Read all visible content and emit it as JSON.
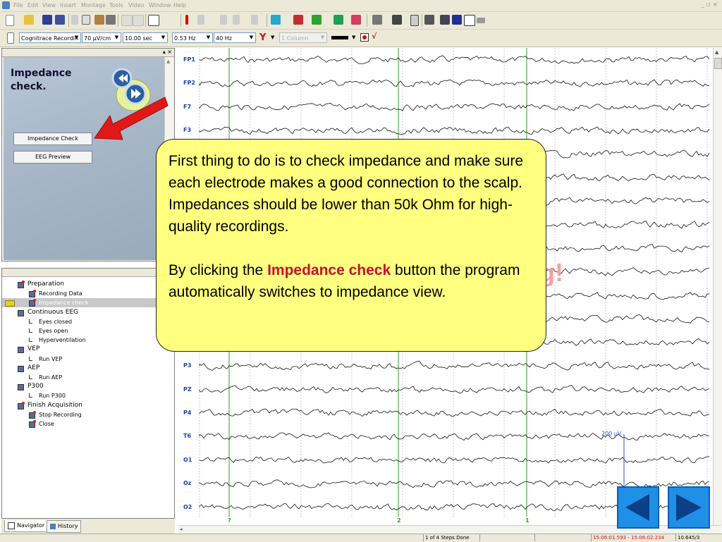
{
  "menu": [
    "File",
    "Edit",
    "View",
    "Insert",
    "Montage",
    "Tools",
    "Video",
    "Window",
    "Help"
  ],
  "window_buttons": "_ ▫ ×",
  "toolbar2": {
    "montage": "Cognitrace Recordin",
    "sensitivity": "70 µV/cm",
    "timebase": "10.00 sec",
    "lowcut": "0.53 Hz",
    "highcut": "40 Hz",
    "columns": "1 Column"
  },
  "left_panel": {
    "pane_buttons": "▴ ×",
    "title_line1": "Impedance",
    "title_line2": "check.",
    "impedance_button": "Impedance Check",
    "eeg_preview_button": "EEG Preview"
  },
  "tree": [
    {
      "label": "Preparation",
      "level": 0,
      "icon": "step-flag-icon"
    },
    {
      "label": "Recording Data",
      "level": 1,
      "icon": "step-flag-icon"
    },
    {
      "label": "Impedance check",
      "level": 1,
      "icon": "step-flag-icon",
      "selected": true
    },
    {
      "label": "Continuous EEG",
      "level": 0,
      "icon": "step-icon"
    },
    {
      "label": "Eyes closed",
      "level": 1,
      "icon": "step-item-icon"
    },
    {
      "label": "Eyes open",
      "level": 1,
      "icon": "step-item-icon"
    },
    {
      "label": "Hyperventilation",
      "level": 1,
      "icon": "step-item-icon"
    },
    {
      "label": "VEP",
      "level": 0,
      "icon": "step-icon"
    },
    {
      "label": "Run VEP",
      "level": 1,
      "icon": "step-item-icon"
    },
    {
      "label": "AEP",
      "level": 0,
      "icon": "step-icon"
    },
    {
      "label": "Run AEP",
      "level": 1,
      "icon": "step-item-icon"
    },
    {
      "label": "P300",
      "level": 0,
      "icon": "step-icon"
    },
    {
      "label": "Run P300",
      "level": 1,
      "icon": "step-item-icon"
    },
    {
      "label": "Finish Acquisition",
      "level": 0,
      "icon": "step-flag-icon"
    },
    {
      "label": "Stop Recording",
      "level": 1,
      "icon": "step-flag-icon"
    },
    {
      "label": "Close",
      "level": 1,
      "icon": "step-flag-icon"
    }
  ],
  "bottom_tabs": {
    "navigator": "Navigator",
    "history": "History"
  },
  "eeg": {
    "channels": [
      "FP1",
      "FP2",
      "F7",
      "F3",
      "",
      "",
      "",
      "",
      "",
      "",
      "",
      "",
      "",
      "P3",
      "PZ",
      "P4",
      "T6",
      "O1",
      "Oz",
      "O2"
    ],
    "markers": [
      "?",
      "2",
      "1"
    ],
    "scale_label": "200 µV",
    "hidden_text_fragment": "g!"
  },
  "callout": {
    "para1": "First thing to do is to check impedance and make sure each electrode makes a good connection to the scalp. Impedances should be lower than 50k Ohm for high-quality recordings.",
    "para2_before": "By clicking the ",
    "para2_highlight": "Impedance check",
    "para2_after": " button the program automatically switches to impedance view."
  },
  "status": {
    "steps": "1 of 4 Steps Done",
    "time_range": "15:06:01.593 - 15:06:02.234",
    "page": "10.645/3"
  },
  "colors": {
    "callout_bg": "#ffff80",
    "highlight": "#c8102e",
    "channel_label": "#1a3fa8",
    "marker_green": "#1fa81f",
    "nav_blue": "#1f8fe8",
    "arrow_red": "#e01818"
  }
}
